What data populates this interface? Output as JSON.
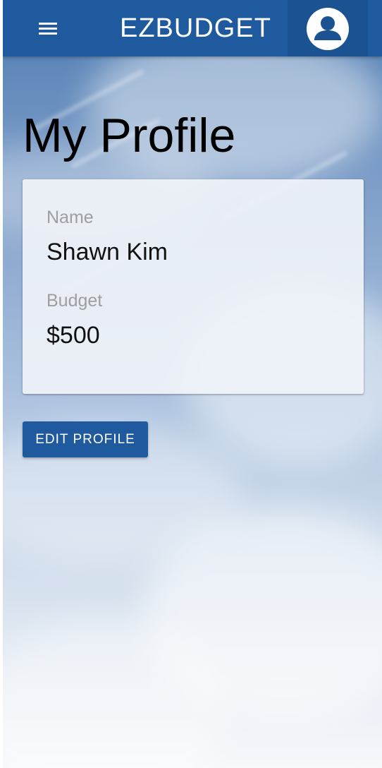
{
  "appbar": {
    "title": "EZBUDGET",
    "menu_icon": "hamburger-menu-icon",
    "account_icon": "account-circle-icon"
  },
  "page": {
    "title": "My Profile"
  },
  "profile_card": {
    "name_label": "Name",
    "name_value": "Shawn Kim",
    "budget_label": "Budget",
    "budget_value": "$500"
  },
  "actions": {
    "edit_label": "EDIT PROFILE"
  },
  "colors": {
    "primary": "#1f5a9e",
    "primary_dark": "#1b5292",
    "label_gray": "#9e9e9e"
  }
}
